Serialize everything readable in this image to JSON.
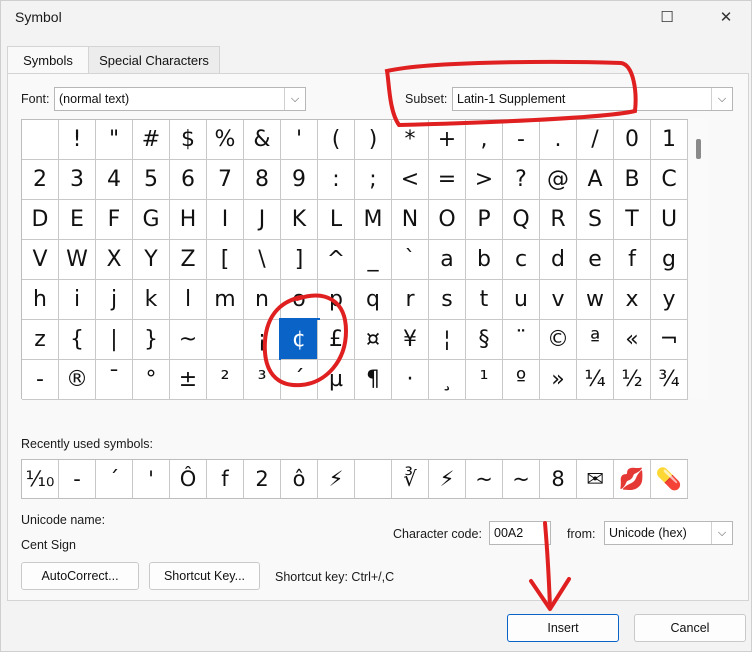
{
  "window": {
    "title": "Symbol"
  },
  "tabs": [
    {
      "label": "Symbols"
    },
    {
      "label": "Special Characters"
    }
  ],
  "font": {
    "label": "Font:",
    "value": "(normal text)"
  },
  "subset": {
    "label": "Subset:",
    "value": "Latin-1 Supplement"
  },
  "symbols": [
    " ",
    "!",
    "\"",
    "#",
    "$",
    "%",
    "&",
    "'",
    "(",
    ")",
    "*",
    "+",
    ",",
    "-",
    ".",
    "/",
    "0",
    "1",
    "2",
    "3",
    "4",
    "5",
    "6",
    "7",
    "8",
    "9",
    ":",
    ";",
    "<",
    "=",
    ">",
    "?",
    "@",
    "A",
    "B",
    "C",
    "D",
    "E",
    "F",
    "G",
    "H",
    "I",
    "J",
    "K",
    "L",
    "M",
    "N",
    "O",
    "P",
    "Q",
    "R",
    "S",
    "T",
    "U",
    "V",
    "W",
    "X",
    "Y",
    "Z",
    "[",
    "\\",
    "]",
    "^",
    "_",
    "`",
    "a",
    "b",
    "c",
    "d",
    "e",
    "f",
    "g",
    "h",
    "i",
    "j",
    "k",
    "l",
    "m",
    "n",
    "o",
    "p",
    "q",
    "r",
    "s",
    "t",
    "u",
    "v",
    "w",
    "x",
    "y",
    "z",
    "{",
    "|",
    "}",
    "~",
    " ",
    "¡",
    "¢",
    "£",
    "¤",
    "¥",
    "¦",
    "§",
    "¨",
    "©",
    "ª",
    "«",
    "¬",
    "-",
    "®",
    "¯",
    "°",
    "±",
    "²",
    "³",
    "´",
    "µ",
    "¶",
    "·",
    "¸",
    "¹",
    "º",
    "»",
    "¼",
    "½",
    "¾"
  ],
  "selected_symbol_index": 97,
  "recent_label": "Recently used symbols:",
  "recent_symbols": [
    "⅒",
    "-",
    "´",
    "'",
    "Ô",
    "f",
    "2",
    "ô",
    "⚡",
    " ",
    "∛",
    "⚡",
    "~",
    "~",
    "8",
    "✉",
    "💋",
    "💊"
  ],
  "unicode_name": {
    "label": "Unicode name:",
    "value": "Cent Sign"
  },
  "character_code": {
    "label": "Character code:",
    "value": "00A2"
  },
  "from": {
    "label": "from:",
    "value": "Unicode (hex)"
  },
  "buttons": {
    "autocorrect": "AutoCorrect...",
    "shortcut_key": "Shortcut Key...",
    "insert": "Insert",
    "cancel": "Cancel"
  },
  "shortcut_text": "Shortcut key: Ctrl+/,C",
  "icons": {
    "maximize": "maximize-icon",
    "close": "close-icon",
    "dropdown": "chevron-down-icon"
  },
  "colors": {
    "selection": "#0a64c8",
    "annotation": "#e02020"
  }
}
